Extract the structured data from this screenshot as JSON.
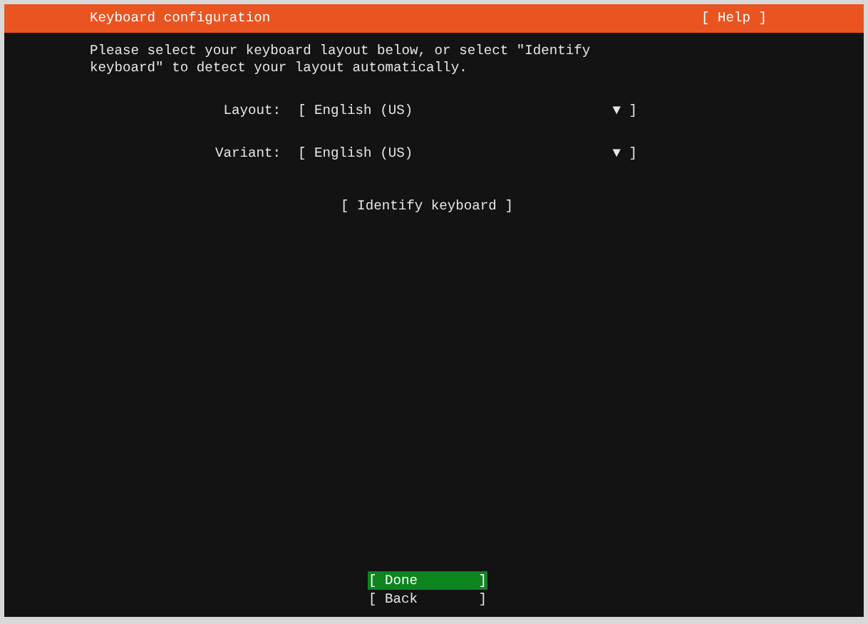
{
  "header": {
    "title": "Keyboard configuration",
    "help": "[ Help ]"
  },
  "instructions": "Please select your keyboard layout below, or select \"Identify keyboard\" to detect your layout automatically.",
  "selectors": [
    {
      "label": "Layout:",
      "open": "[",
      "value": "English (US)",
      "arrow": "▼",
      "close": "]"
    },
    {
      "label": "Variant:",
      "open": "[",
      "value": "English (US)",
      "arrow": "▼",
      "close": "]"
    }
  ],
  "identify_button": "[ Identify keyboard ]",
  "buttons": [
    {
      "open": "[",
      "label": "Done",
      "close": "]",
      "selected": true
    },
    {
      "open": "[",
      "label": "Back",
      "close": "]",
      "selected": false
    }
  ]
}
